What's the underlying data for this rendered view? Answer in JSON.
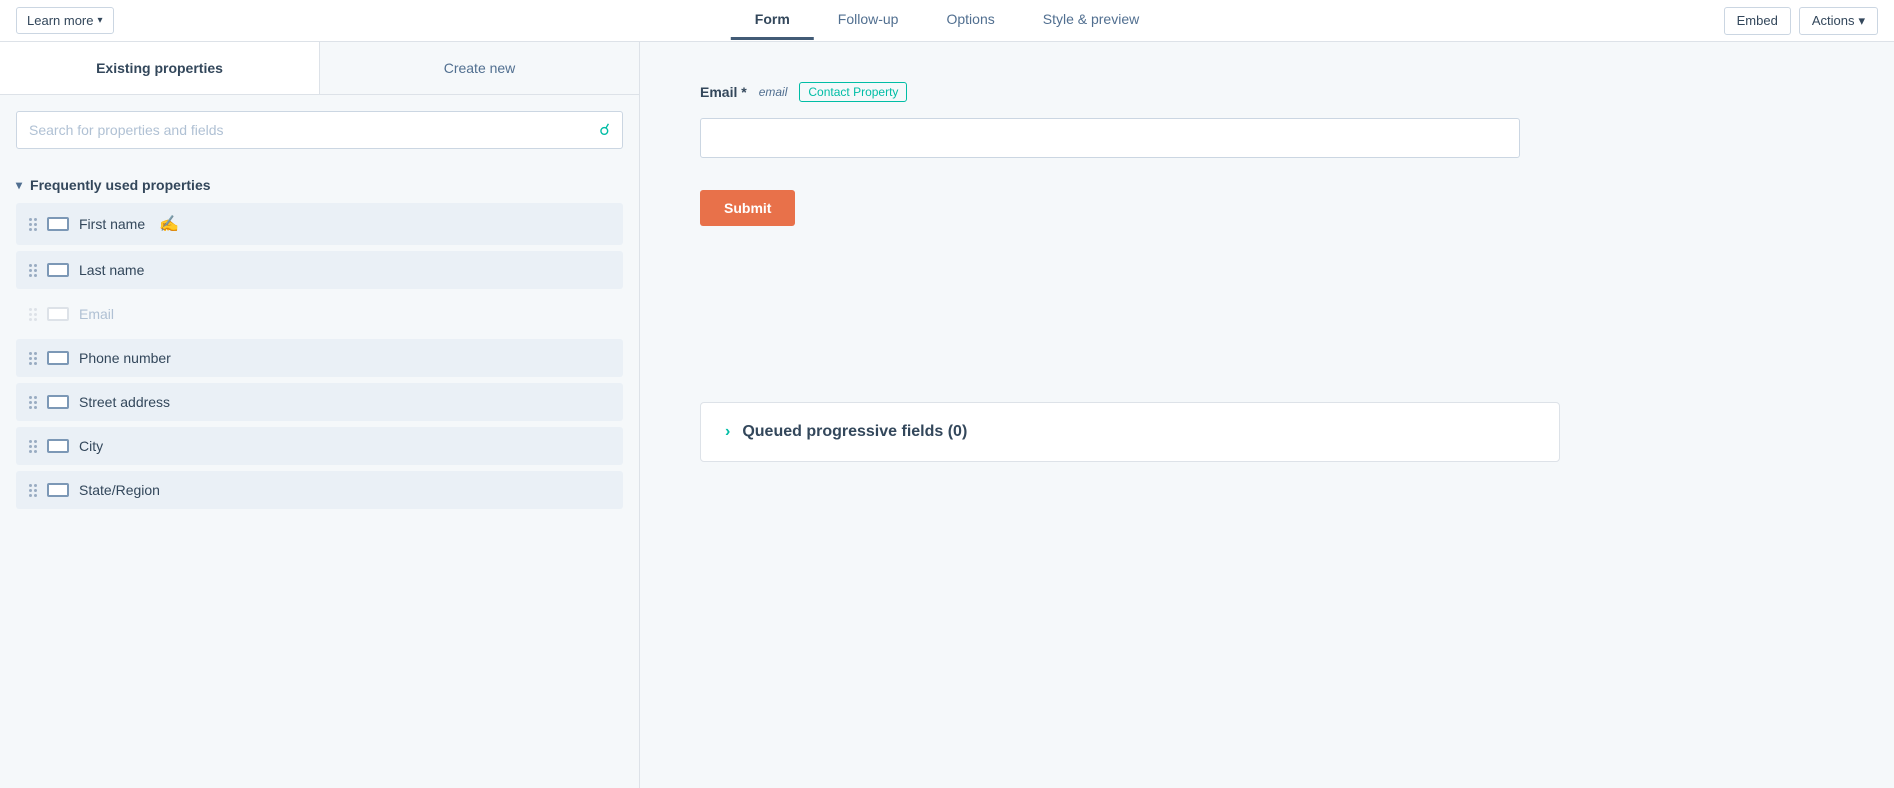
{
  "topNav": {
    "learnMore": "Learn more",
    "tabs": [
      {
        "id": "form",
        "label": "Form",
        "active": true
      },
      {
        "id": "followup",
        "label": "Follow-up",
        "active": false
      },
      {
        "id": "options",
        "label": "Options",
        "active": false
      },
      {
        "id": "style",
        "label": "Style & preview",
        "active": false
      }
    ],
    "embedLabel": "Embed",
    "actionsLabel": "Actions"
  },
  "leftPanel": {
    "tabs": [
      {
        "id": "existing",
        "label": "Existing properties",
        "active": true
      },
      {
        "id": "create",
        "label": "Create new",
        "active": false
      }
    ],
    "searchPlaceholder": "Search for properties and fields",
    "sectionLabel": "Frequently used properties",
    "properties": [
      {
        "id": "first-name",
        "label": "First name",
        "active": true
      },
      {
        "id": "last-name",
        "label": "Last name",
        "active": true
      },
      {
        "id": "email",
        "label": "Email",
        "active": false
      },
      {
        "id": "phone",
        "label": "Phone number",
        "active": true
      },
      {
        "id": "street",
        "label": "Street address",
        "active": true
      },
      {
        "id": "city",
        "label": "City",
        "active": true
      },
      {
        "id": "state",
        "label": "State/Region",
        "active": true
      }
    ]
  },
  "formPreview": {
    "emailLabel": "Email",
    "required": "*",
    "emailType": "email",
    "contactPropertyBadge": "Contact Property",
    "submitLabel": "Submit"
  },
  "queuedSection": {
    "title": "Queued progressive fields (0)"
  }
}
